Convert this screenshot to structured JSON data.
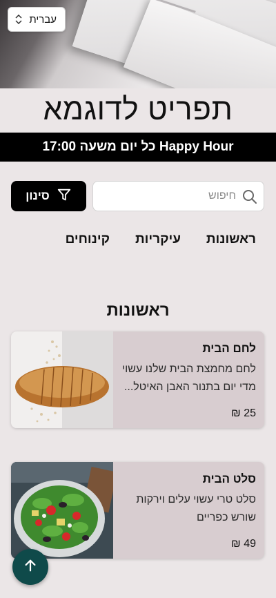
{
  "language_select": {
    "label": "עברית"
  },
  "header": {
    "title": "תפריט לדוגמא"
  },
  "banner": {
    "text": "Happy Hour כל יום משעה 17:00"
  },
  "search": {
    "placeholder": "חיפוש",
    "value": ""
  },
  "filter": {
    "label": "סינון"
  },
  "tabs": [
    {
      "label": "ראשונות"
    },
    {
      "label": "עיקריות"
    },
    {
      "label": "קינוחים"
    }
  ],
  "section": {
    "title": "ראשונות"
  },
  "items": [
    {
      "name": "לחם הבית",
      "description": "לחם מחמצת הבית שלנו עשוי מדי יום בתנור האבן האיטל...",
      "price": "25 ₪"
    },
    {
      "name": "סלט הבית",
      "description": "סלט טרי עשוי עלים וירקות שורש כפריים",
      "price": "49 ₪"
    }
  ],
  "colors": {
    "background": "#ebe6e7",
    "card": "#d8cdd0",
    "fab": "#0f4a4a",
    "banner": "#000000"
  },
  "icons": {
    "select": "chevron-up-down-icon",
    "search": "search-icon",
    "filter": "filter-icon",
    "scroll_top": "arrow-up-icon"
  }
}
